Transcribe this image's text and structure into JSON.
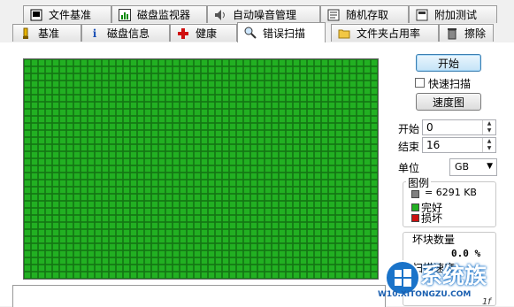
{
  "tabs_row1": [
    {
      "label": "文件基准",
      "icon": "disk-icon"
    },
    {
      "label": "磁盘监视器",
      "icon": "monitor-chart-icon"
    },
    {
      "label": "自动噪音管理",
      "icon": "speaker-icon"
    },
    {
      "label": "随机存取",
      "icon": "random-access-icon"
    },
    {
      "label": "附加测试",
      "icon": "extra-test-icon"
    }
  ],
  "tabs_row2": [
    {
      "label": "基准",
      "icon": "benchmark-icon"
    },
    {
      "label": "磁盘信息",
      "icon": "info-icon"
    },
    {
      "label": "健康",
      "icon": "health-cross-icon"
    },
    {
      "label": "错误扫描",
      "icon": "magnifier-icon",
      "active": true
    },
    {
      "label": "文件夹占用率",
      "icon": "folder-icon"
    },
    {
      "label": "擦除",
      "icon": "trash-icon"
    }
  ],
  "controls": {
    "start_button": "开始",
    "quick_scan_label": "快速扫描",
    "quick_scan_checked": false,
    "speed_map_button": "速度图",
    "start_label": "开始",
    "start_value": "0",
    "end_label": "结束",
    "end_value": "16",
    "unit_label": "单位",
    "unit_value": "GB"
  },
  "legend": {
    "title": "图例",
    "block_size": "= 6291 KB",
    "ok_label": "完好",
    "bad_label": "损坏",
    "colors": {
      "block": "#808080",
      "ok": "#22b022",
      "bad": "#cc1111"
    }
  },
  "bad_blocks": {
    "title": "坏块数量",
    "value": "0.0 %",
    "scan_speed_label": "扫描速度"
  },
  "watermark": {
    "brand": "系统族",
    "site": "W10.XITONGZU.COM",
    "partial_text": "1f"
  },
  "scan_grid": {
    "rows": 31,
    "cols": 50,
    "ok_color": "#22b022",
    "line_color": "#0f6a0f"
  }
}
